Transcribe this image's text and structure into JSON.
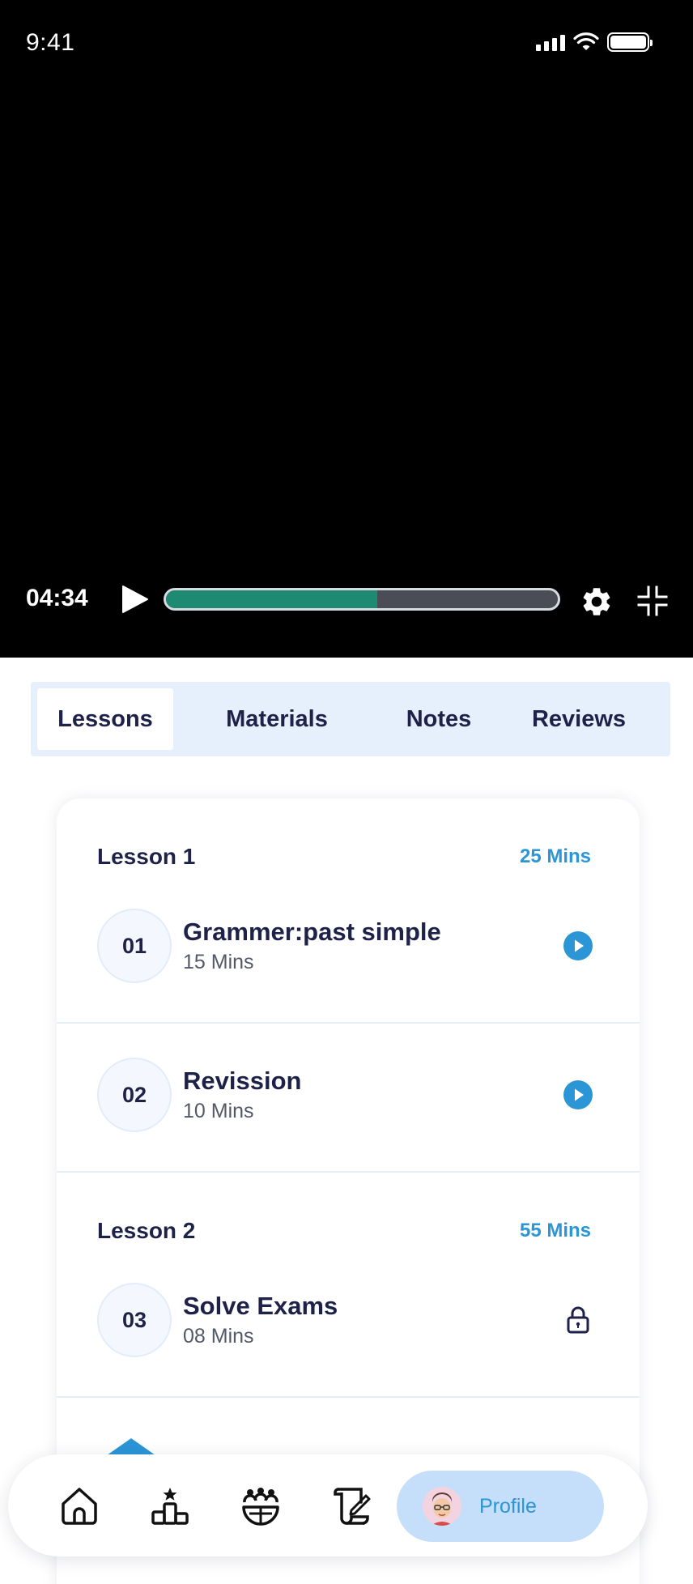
{
  "status_bar": {
    "time": "9:41"
  },
  "player": {
    "current_time": "04:34",
    "progress_fraction": 0.54,
    "colors": {
      "progress_fill": "#1e8a72",
      "progress_track": "#4a4d55"
    }
  },
  "tabs": [
    {
      "label": "Lessons",
      "active": true
    },
    {
      "label": "Materials",
      "active": false
    },
    {
      "label": "Notes",
      "active": false
    },
    {
      "label": "Reviews",
      "active": false
    }
  ],
  "sections": [
    {
      "title": "Lesson 1",
      "duration": "25 Mins",
      "items": [
        {
          "number": "01",
          "title": "Grammer:past simple",
          "duration": "15 Mins",
          "icon": "play-circle-icon",
          "locked": false
        },
        {
          "number": "02",
          "title": "Revission",
          "duration": "10 Mins",
          "icon": "play-circle-icon",
          "locked": false
        }
      ]
    },
    {
      "title": "Lesson 2",
      "duration": "55 Mins",
      "items": [
        {
          "number": "03",
          "title": "Solve Exams",
          "duration": "08 Mins",
          "icon": "lock-icon",
          "locked": true
        }
      ]
    }
  ],
  "bottom_nav": {
    "items": [
      {
        "icon": "home-icon"
      },
      {
        "icon": "leaderboard-icon"
      },
      {
        "icon": "community-icon"
      },
      {
        "icon": "edit-scroll-icon"
      }
    ],
    "profile_label": "Profile"
  },
  "colors": {
    "accent": "#2b95d6",
    "dark_text": "#1e2148",
    "tab_bg": "#e6f0fd",
    "profile_pill": "#c5def9"
  }
}
